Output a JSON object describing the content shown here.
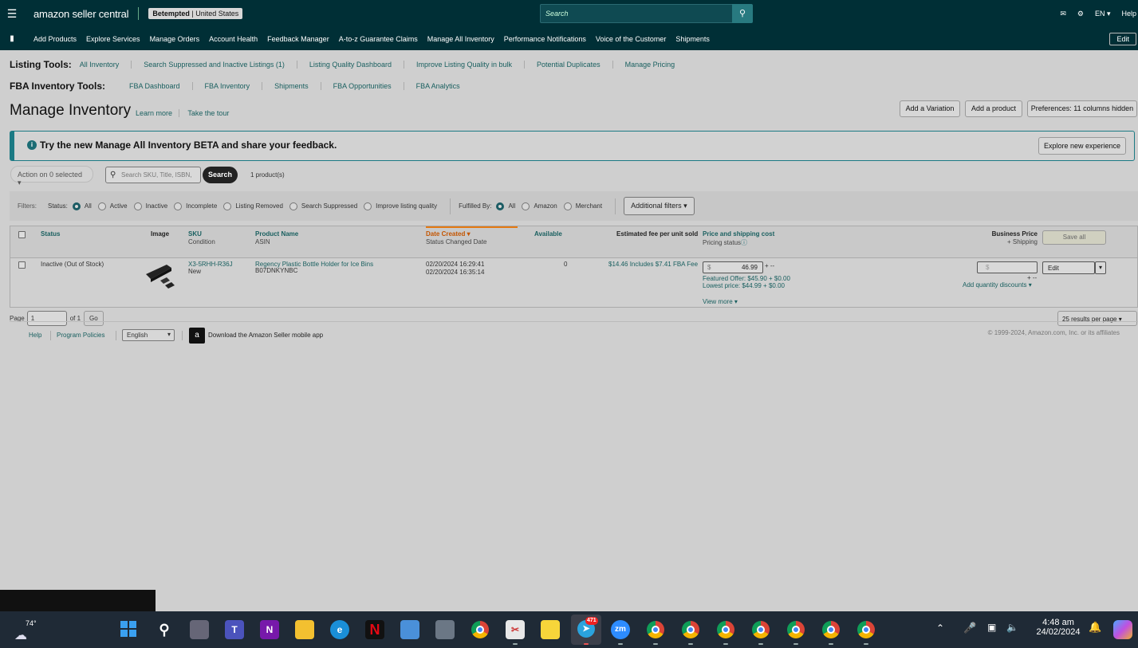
{
  "header": {
    "logo": "amazon seller central",
    "account_name": "Betempted",
    "account_region": "United States",
    "search_placeholder": "Search",
    "language": "EN",
    "help": "Help"
  },
  "nav": {
    "items": [
      "Add Products",
      "Explore Services",
      "Manage Orders",
      "Account Health",
      "Feedback Manager",
      "A-to-z Guarantee Claims",
      "Manage All Inventory",
      "Performance Notifications",
      "Voice of the Customer",
      "Shipments"
    ],
    "edit": "Edit"
  },
  "listing_tools": {
    "title": "Listing Tools:",
    "links": [
      "All Inventory",
      "Search Suppressed and Inactive Listings (1)",
      "Listing Quality Dashboard",
      "Improve Listing Quality in bulk",
      "Potential Duplicates",
      "Manage Pricing"
    ]
  },
  "fba_tools": {
    "title": "FBA Inventory Tools:",
    "links": [
      "FBA Dashboard",
      "FBA Inventory",
      "Shipments",
      "FBA Opportunities",
      "FBA Analytics"
    ]
  },
  "page": {
    "title": "Manage Inventory",
    "learn_more": "Learn more",
    "take_tour": "Take the tour",
    "add_variation": "Add a Variation",
    "add_product": "Add a product",
    "preferences": "Preferences: 11 columns hidden"
  },
  "banner": {
    "text": "Try the new Manage All Inventory BETA and share your feedback.",
    "button": "Explore new experience"
  },
  "toolbar": {
    "action": "Action on 0 selected",
    "search_placeholder": "Search SKU, Title, ISBN,",
    "search_button": "Search",
    "count": "1 product(s)"
  },
  "filters": {
    "label": "Filters:",
    "status_label": "Status:",
    "status_options": [
      "All",
      "Active",
      "Inactive",
      "Incomplete",
      "Listing Removed",
      "Search Suppressed",
      "Improve listing quality"
    ],
    "fulfilled_label": "Fulfilled By:",
    "fulfilled_options": [
      "All",
      "Amazon",
      "Merchant"
    ],
    "additional": "Additional filters"
  },
  "table": {
    "headers": {
      "status": "Status",
      "image": "Image",
      "sku": "SKU",
      "sku_sub": "Condition",
      "product_name": "Product Name",
      "product_sub": "ASIN",
      "date_created": "Date Created",
      "date_sub": "Status Changed Date",
      "available": "Available",
      "fee": "Estimated fee per unit sold",
      "price": "Price and shipping cost",
      "price_sub": "Pricing status",
      "business": "Business Price",
      "business_sub": "+ Shipping",
      "save_all": "Save all"
    },
    "row": {
      "status": "Inactive (Out of Stock)",
      "sku": "X3-5RHH-R36J",
      "condition": "New",
      "product_name": "Regency Plastic Bottle Holder for Ice Bins",
      "asin": "B07DNKYNBC",
      "date_created": "02/20/2024 16:29:41",
      "status_changed": "02/20/2024 16:35:14",
      "available": "0",
      "fee": "$14.46 Includes $7.41 FBA Fee",
      "price_symbol": "$",
      "price": "46.99",
      "price_plus": "+ --",
      "featured": "Featured Offer: $45.90 + $0.00",
      "lowest": "Lowest price: $44.99 + $0.00",
      "view_more": "View more",
      "business_symbol": "$",
      "business_plus": "+ --",
      "add_qty": "Add quantity discounts",
      "edit": "Edit"
    }
  },
  "pager": {
    "page_label": "Page",
    "page_value": "1",
    "of": "of 1",
    "go": "Go",
    "per_page": "25 results per page"
  },
  "footer": {
    "help": "Help",
    "policies": "Program Policies",
    "language": "English",
    "app": "Download the Amazon Seller mobile app",
    "copyright": "© 1999-2024, Amazon.com, Inc. or its affiliates"
  },
  "taskbar": {
    "weather": "74°",
    "time": "4:48 am",
    "date": "24/02/2024",
    "telegram_badge": "471"
  }
}
